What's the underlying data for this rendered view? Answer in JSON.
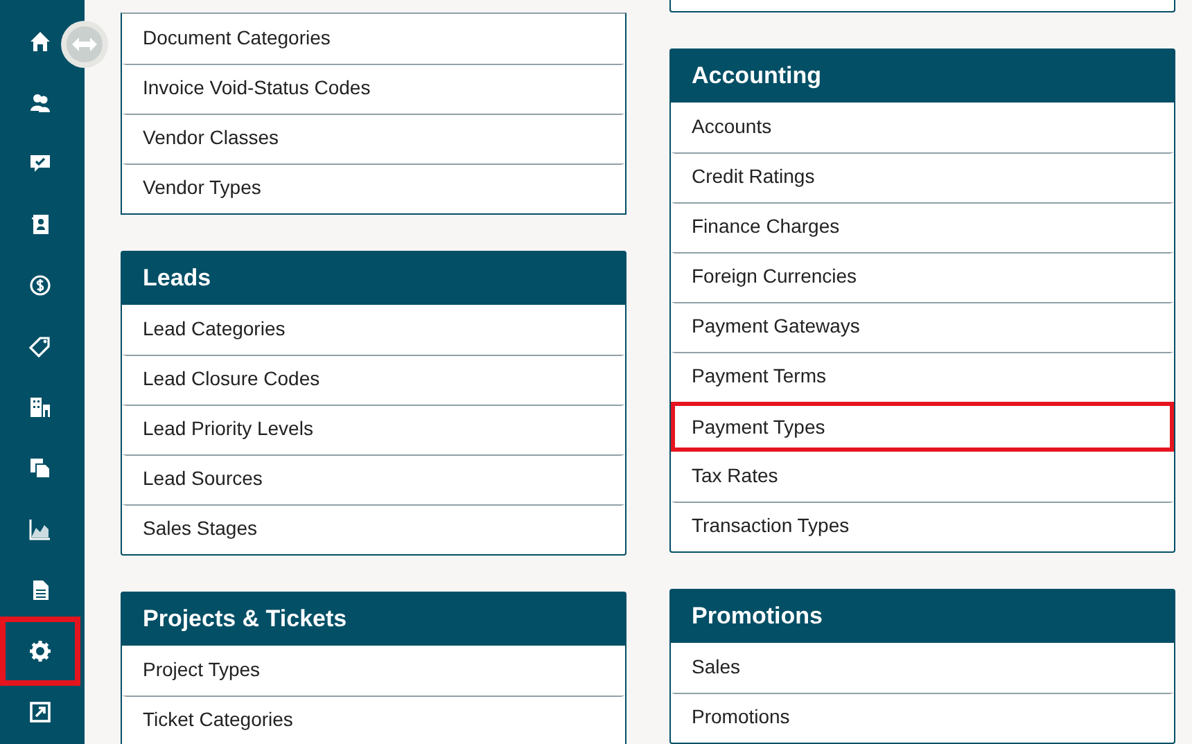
{
  "sidebar": {
    "items": [
      {
        "selected": false
      },
      {
        "selected": false
      },
      {
        "selected": false
      },
      {
        "selected": false
      },
      {
        "selected": false
      },
      {
        "selected": false
      },
      {
        "selected": false
      },
      {
        "selected": false
      },
      {
        "selected": false
      },
      {
        "selected": false
      },
      {
        "selected": true
      },
      {
        "selected": false
      }
    ]
  },
  "columns": [
    {
      "cards": [
        {
          "items": [
            {
              "label": "Document Categories",
              "selected": false
            },
            {
              "label": "Invoice Void-Status Codes",
              "selected": false
            },
            {
              "label": "Vendor Classes",
              "selected": false
            },
            {
              "label": "Vendor Types",
              "selected": false
            }
          ]
        },
        {
          "title": "Leads",
          "items": [
            {
              "label": "Lead Categories",
              "selected": false
            },
            {
              "label": "Lead Closure Codes",
              "selected": false
            },
            {
              "label": "Lead Priority Levels",
              "selected": false
            },
            {
              "label": "Lead Sources",
              "selected": false
            },
            {
              "label": "Sales Stages",
              "selected": false
            }
          ]
        },
        {
          "title": "Projects & Tickets",
          "items": [
            {
              "label": "Project Types",
              "selected": false
            },
            {
              "label": "Ticket Categories",
              "selected": false
            }
          ]
        }
      ]
    },
    {
      "cards": [
        {
          "title": "Accounting",
          "items": [
            {
              "label": "Accounts",
              "selected": false
            },
            {
              "label": "Credit Ratings",
              "selected": false
            },
            {
              "label": "Finance Charges",
              "selected": false
            },
            {
              "label": "Foreign Currencies",
              "selected": false
            },
            {
              "label": "Payment Gateways",
              "selected": false
            },
            {
              "label": "Payment Terms",
              "selected": false
            },
            {
              "label": "Payment Types",
              "selected": true
            },
            {
              "label": "Tax Rates",
              "selected": false
            },
            {
              "label": "Transaction Types",
              "selected": false
            }
          ]
        },
        {
          "title": "Promotions",
          "items": [
            {
              "label": "Sales",
              "selected": false
            },
            {
              "label": "Promotions",
              "selected": false
            }
          ]
        }
      ]
    }
  ]
}
